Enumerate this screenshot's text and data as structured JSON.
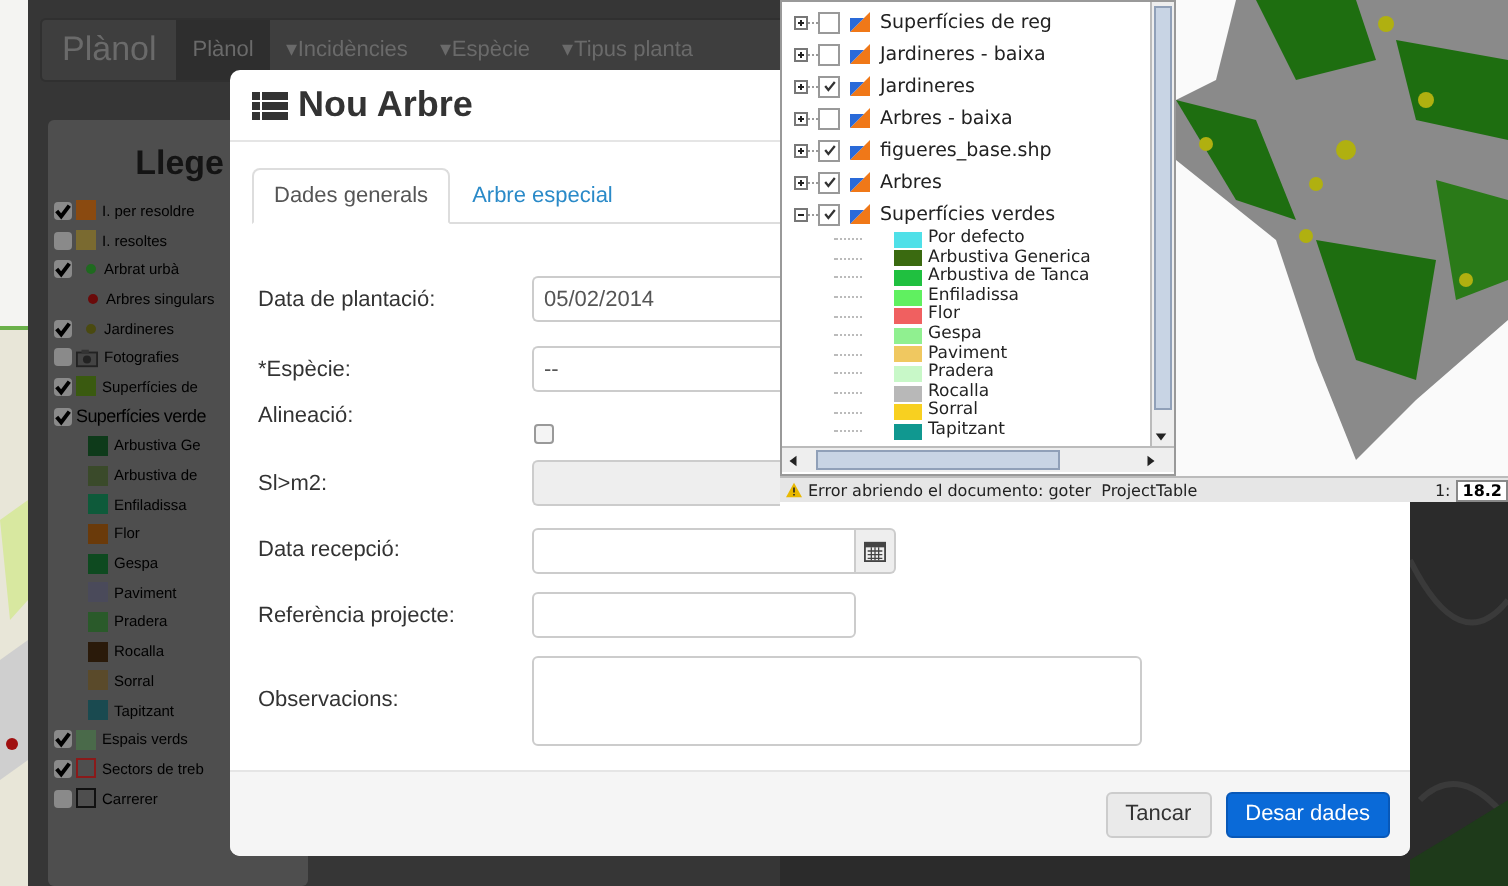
{
  "app": {
    "brand": "Plànol",
    "nav": [
      {
        "label": "Plànol",
        "selected": true
      },
      {
        "label": "▾Incidències",
        "selected": false
      },
      {
        "label": "▾Espècie",
        "selected": false
      },
      {
        "label": "▾Tipus planta",
        "selected": false
      }
    ]
  },
  "legend": {
    "title": "Llege",
    "items": [
      {
        "label": "I. per resoldre",
        "kind": "swatch",
        "color": "#8a4a10",
        "checked": true
      },
      {
        "label": "I. resoltes",
        "kind": "swatch",
        "color": "#7a6a30",
        "checked": false
      },
      {
        "label": "Arbrat urbà",
        "kind": "dot",
        "color": "#1f6a1f",
        "checked": true
      },
      {
        "label": "Arbres singulars",
        "kind": "dot",
        "color": "#6a0a0a"
      },
      {
        "label": "Jardineres",
        "kind": "dot",
        "color": "#4a4a10",
        "checked": true
      },
      {
        "label": "Fotografies",
        "kind": "camera",
        "checked": false
      },
      {
        "label": "Superfícies de",
        "kind": "swatch",
        "color": "#3a5a10",
        "checked": true
      },
      {
        "label": "Superfícies verde",
        "kind": "none",
        "checked": true,
        "children": [
          {
            "label": "Arbustiva Ge",
            "color": "#0e3a1a"
          },
          {
            "label": "Arbustiva de",
            "color": "#3a4a2a"
          },
          {
            "label": "Enfiladissa",
            "color": "#0e5a3a"
          },
          {
            "label": "Flor",
            "color": "#6a3a0a"
          },
          {
            "label": "Gespa",
            "color": "#0e4a20"
          },
          {
            "label": "Paviment",
            "color": "#4a4a5a"
          },
          {
            "label": "Pradera",
            "color": "#2a5a2a"
          },
          {
            "label": "Rocalla",
            "color": "#2a1a0a"
          },
          {
            "label": "Sorral",
            "color": "#5a4a2a"
          },
          {
            "label": "Tapitzant",
            "color": "#1a4a50"
          }
        ]
      },
      {
        "label": "Espais verds",
        "kind": "swatch",
        "color": "#4a6a4a",
        "checked": true
      },
      {
        "label": "Sectors de treb",
        "kind": "outline",
        "color": "#8a1a1a",
        "checked": true
      },
      {
        "label": "Carrerer",
        "kind": "outline",
        "color": "#111111",
        "checked": false
      }
    ]
  },
  "dialog": {
    "title": "Nou Arbre",
    "tabs": [
      {
        "label": "Dades generals",
        "selected": true
      },
      {
        "label": "Arbre especial",
        "selected": false
      }
    ],
    "fields": [
      {
        "label": "Data de plantació:",
        "kind": "wide_text",
        "value": "05/02/2014"
      },
      {
        "label": "*Espècie:",
        "kind": "wide_text",
        "value": "--"
      },
      {
        "label": "Alineació:",
        "kind": "checkbox",
        "checked": false
      },
      {
        "label": "Sl>m2:",
        "kind": "wide_text",
        "disabled": true
      },
      {
        "label": "Data recepció:",
        "kind": "date"
      },
      {
        "label": "Referència projecte:",
        "kind": "text"
      },
      {
        "label": "Observacions:",
        "kind": "textarea"
      }
    ],
    "buttons": [
      {
        "label": "Tancar",
        "kind": "default"
      },
      {
        "label": "Desar dades",
        "kind": "primary"
      }
    ]
  },
  "gis": {
    "layers": [
      {
        "label": "Superfícies de reg",
        "checked": false,
        "expanded": false
      },
      {
        "label": "Jardineres - baixa",
        "checked": false,
        "expanded": false
      },
      {
        "label": "Jardineres",
        "checked": true,
        "expanded": false
      },
      {
        "label": "Arbres - baixa",
        "checked": false,
        "expanded": false
      },
      {
        "label": "figueres_base.shp",
        "checked": true,
        "expanded": false
      },
      {
        "label": "Arbres",
        "checked": true,
        "expanded": false
      },
      {
        "label": "Superfícies verdes",
        "checked": true,
        "expanded": true,
        "children": [
          {
            "label": "Por defecto",
            "color": "#4fe0e8"
          },
          {
            "label": "Arbustiva Generica",
            "color": "#3a6a10"
          },
          {
            "label": "Arbustiva de Tanca",
            "color": "#20c040"
          },
          {
            "label": "Enfiladissa",
            "color": "#60f060"
          },
          {
            "label": "Flor",
            "color": "#f06060"
          },
          {
            "label": "Gespa",
            "color": "#90f090"
          },
          {
            "label": "Paviment",
            "color": "#f0c860"
          },
          {
            "label": "Pradera",
            "color": "#c8f8c8"
          },
          {
            "label": "Rocalla",
            "color": "#b8b8b8"
          },
          {
            "label": "Sorral",
            "color": "#f8d020"
          },
          {
            "label": "Tapitzant",
            "color": "#109890"
          }
        ]
      }
    ],
    "status": "Error abriendo el documento: goter  ProjectTable",
    "scale_label": "1:",
    "scale_value": "18.2"
  }
}
